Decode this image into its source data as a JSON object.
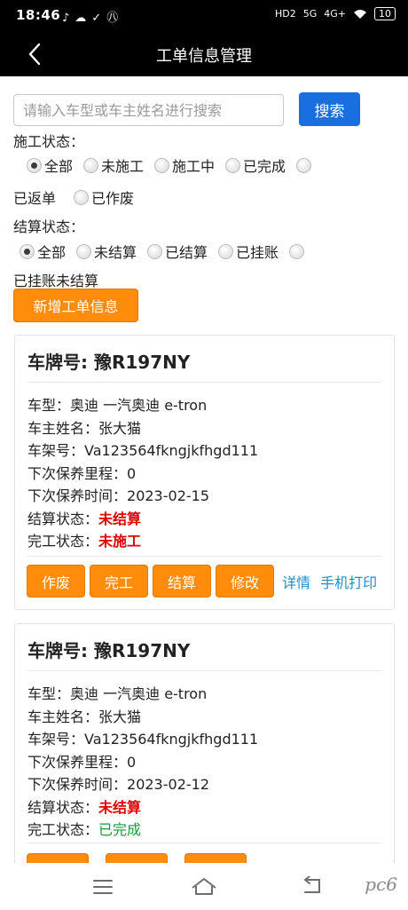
{
  "status_bar": {
    "time": "18:46",
    "left_icons": "♪☁✓㊇",
    "network_label": "HD2",
    "network_5g": "5G",
    "network_4g": "4G+",
    "battery": "10"
  },
  "nav": {
    "title": "工单信息管理"
  },
  "search": {
    "placeholder": "请输入车型或车主姓名进行搜索",
    "button_label": "搜索"
  },
  "construction_filter": {
    "label": "施工状态：",
    "options": [
      "全部",
      "未施工",
      "施工中",
      "已完成",
      "已返单",
      "已作废"
    ],
    "selected": "全部"
  },
  "settlement_filter": {
    "label": "结算状态：",
    "options": [
      "全部",
      "未结算",
      "已结算",
      "已挂账",
      "已挂账未结算"
    ],
    "selected": "全部"
  },
  "add_button": "新增工单信息",
  "cards": [
    {
      "plate": "车牌号: 豫R197NY",
      "model_label": "车型：",
      "model": "奥迪 一汽奥迪 e-tron",
      "owner_label": "车主姓名：",
      "owner": "张大猫",
      "vin_label": "车架号：",
      "vin": "Va123564fkngjkfhgd111",
      "mileage_label": "下次保养里程：",
      "mileage": "0",
      "date_label": "下次保养时间：",
      "date": "2023-02-15",
      "settle_label": "结算状态：",
      "settle": "未结算",
      "work_label": "完工状态：",
      "work": "未施工",
      "actions": [
        "作废",
        "完工",
        "结算",
        "修改"
      ],
      "links": [
        "详情",
        "手机打印"
      ]
    },
    {
      "plate": "车牌号: 豫R197NY",
      "model_label": "车型：",
      "model": "奥迪 一汽奥迪 e-tron",
      "owner_label": "车主姓名：",
      "owner": "张大猫",
      "vin_label": "车架号：",
      "vin": "Va123564fkngjkfhgd111",
      "mileage_label": "下次保养里程：",
      "mileage": "0",
      "date_label": "下次保养时间：",
      "date": "2023-02-12",
      "settle_label": "结算状态：",
      "settle": "未结算",
      "work_label": "完工状态：",
      "work": "已完成"
    }
  ],
  "watermark": "pc6",
  "colors": {
    "primary_blue": "#1a6fe0",
    "action_orange": "#ff8c0b",
    "status_red": "#e00000",
    "status_green": "#1a9a3a",
    "link_blue": "#1a90c8"
  }
}
